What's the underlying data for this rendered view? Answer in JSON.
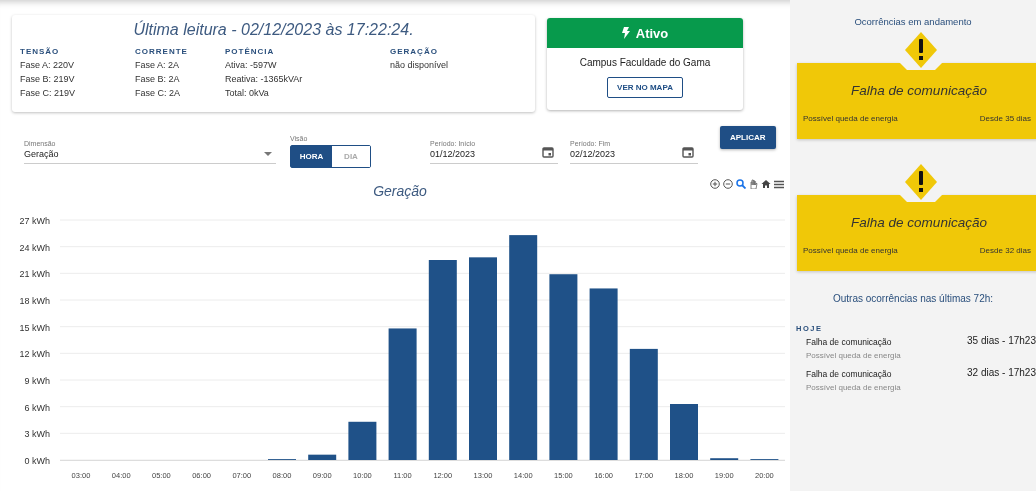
{
  "reading": {
    "title": "Última leitura - 02/12/2023 às 17:22:24.",
    "groups": [
      {
        "label": "TENSÃO",
        "lines": [
          "Fase A: 220V",
          "Fase B: 219V",
          "Fase C: 219V"
        ]
      },
      {
        "label": "CORRENTE",
        "lines": [
          "Fase A: 2A",
          "Fase B: 2A",
          "Fase C: 2A"
        ]
      },
      {
        "label": "POTÊNCIA",
        "lines": [
          "Ativa: -597W",
          "Reativa: -1365kVAr",
          "Total: 0kVa"
        ]
      },
      {
        "label": "GERAÇÃO",
        "lines": [
          "não disponível"
        ]
      }
    ]
  },
  "status": {
    "state": "Ativo",
    "active": true,
    "location": "Campus Faculdade do Gama",
    "map_button": "VER NO MAPA"
  },
  "filters": {
    "dimension": {
      "label": "Dimensão",
      "value": "Geração"
    },
    "view": {
      "label": "Visão",
      "options": [
        {
          "label": "HORA",
          "selected": true
        },
        {
          "label": "DIA",
          "selected": false
        }
      ]
    },
    "start": {
      "label": "Período: Início",
      "value": "01/12/2023"
    },
    "end": {
      "label": "Período: Fim",
      "value": "02/12/2023"
    },
    "apply_button": "APLICAR"
  },
  "chart": {
    "chart_data": {
      "type": "bar",
      "title": "Geração",
      "categories": [
        "03:00",
        "04:00",
        "05:00",
        "06:00",
        "07:00",
        "08:00",
        "09:00",
        "10:00",
        "11:00",
        "12:00",
        "13:00",
        "14:00",
        "15:00",
        "16:00",
        "17:00",
        "18:00",
        "19:00",
        "20:00"
      ],
      "grid": true,
      "series": [
        {
          "color": "#1f5188",
          "values": [
            0,
            0,
            0,
            0,
            0,
            0.1,
            0.6,
            4.3,
            14.8,
            22.5,
            22.8,
            25.3,
            20.9,
            19.3,
            12.5,
            6.3,
            0.2,
            0.1
          ]
        }
      ],
      "ylim": [
        0,
        27
      ],
      "yticks": [
        {
          "value": 0,
          "label": "0 kWh"
        },
        {
          "value": 3,
          "label": "3 kWh"
        },
        {
          "value": 6,
          "label": "6 kWh"
        },
        {
          "value": 9,
          "label": "9 kWh"
        },
        {
          "value": 12,
          "label": "12 kWh"
        },
        {
          "value": 15,
          "label": "15 kWh"
        },
        {
          "value": 18,
          "label": "18 kWh"
        },
        {
          "value": 21,
          "label": "21 kWh"
        },
        {
          "value": 24,
          "label": "24 kWh"
        },
        {
          "value": 27,
          "label": "27 kWh"
        }
      ]
    }
  },
  "side": {
    "title": "Ocorrências em andamento",
    "current": [
      {
        "title": "Falha de comunicação",
        "description": "Possível queda de energia",
        "since": "Desde 35 dias"
      },
      {
        "title": "Falha de comunicação",
        "description": "Possível queda de energia",
        "since": "Desde 32 dias"
      }
    ],
    "other_title": "Outras ocorrências nas últimas 72h:",
    "other_groups": [
      {
        "label": "HOJE",
        "items": [
          {
            "title": "Falha de comunicação",
            "description": "Possível queda de energia",
            "time": "35 dias - 17h23"
          },
          {
            "title": "Falha de comunicação",
            "description": "Possível queda de energia",
            "time": "32 dias - 17h23"
          }
        ]
      }
    ]
  }
}
